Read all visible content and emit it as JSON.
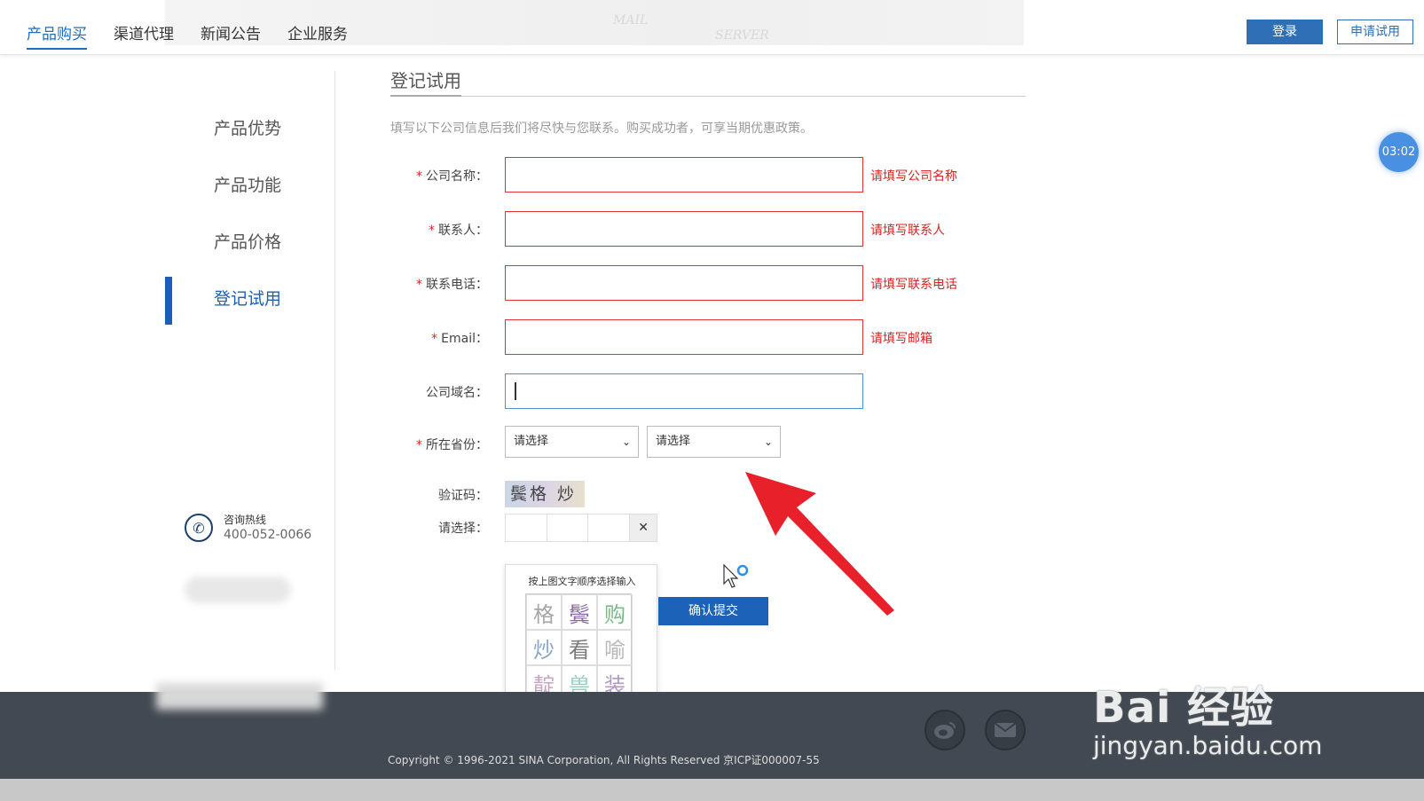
{
  "topbar": {
    "nav": [
      {
        "label": "产品购买",
        "active": true
      },
      {
        "label": "渠道代理",
        "active": false
      },
      {
        "label": "新闻公告",
        "active": false
      },
      {
        "label": "企业服务",
        "active": false
      }
    ],
    "login_label": "登录",
    "trial_label": "申请试用",
    "banner_text_1": "MAIL",
    "banner_text_2": "SERVER"
  },
  "sidebar": {
    "items": [
      {
        "label": "产品优势"
      },
      {
        "label": "产品功能"
      },
      {
        "label": "产品价格"
      },
      {
        "label": "登记试用",
        "active": true
      }
    ],
    "hotline_label": "咨询热线",
    "hotline_number": "400-052-0066"
  },
  "form": {
    "title": "登记试用",
    "hint": "填写以下公司信息后我们将尽快与您联系。购买成功者，可享当期优惠政策。",
    "fields": [
      {
        "label": "公司名称：",
        "required": true,
        "value": "",
        "error": "请填写公司名称"
      },
      {
        "label": "联系人：",
        "required": true,
        "value": "",
        "error": "请填写联系人"
      },
      {
        "label": "联系电话：",
        "required": true,
        "value": "",
        "error": "请填写联系电话"
      },
      {
        "label": "Email：",
        "required": true,
        "value": "",
        "error": "请填写邮箱"
      },
      {
        "label": "公司域名：",
        "required": false,
        "value": "",
        "error": ""
      }
    ],
    "province_label": "所在省份：",
    "province_select_1": "请选择",
    "province_select_2": "请选择",
    "captcha_label": "验证码：",
    "captcha_text": "鬓格 炒",
    "choose_label": "请选择：",
    "captcha_close": "✕",
    "submit_label": "确认提交"
  },
  "captcha_popup": {
    "title": "按上图文字顺序选择输入",
    "chars": [
      "格",
      "鬓",
      "购",
      "炒",
      "看",
      "喻",
      "靛",
      "兽",
      "装"
    ],
    "colors": [
      "#a6a6a6",
      "#8a6aa8",
      "#7cb98a",
      "#8aa6c2",
      "#7a7a7a",
      "#b8b8b8",
      "#c8a6c2",
      "#9ad0c2",
      "#b19ac2"
    ]
  },
  "timer": "03:02",
  "footer": {
    "copyright": "Copyright © 1996-2021 SINA Corporation, All Rights Reserved 京ICP证000007-55",
    "weibo_icon": "weibo-icon",
    "mail_icon": "mail-icon"
  },
  "watermark": {
    "main": "Bai 经验",
    "sub": "jingyan.baidu.com"
  },
  "colors": {
    "accent": "#1d5eb8",
    "error": "#dd2222",
    "arrow": "#e8202a"
  }
}
